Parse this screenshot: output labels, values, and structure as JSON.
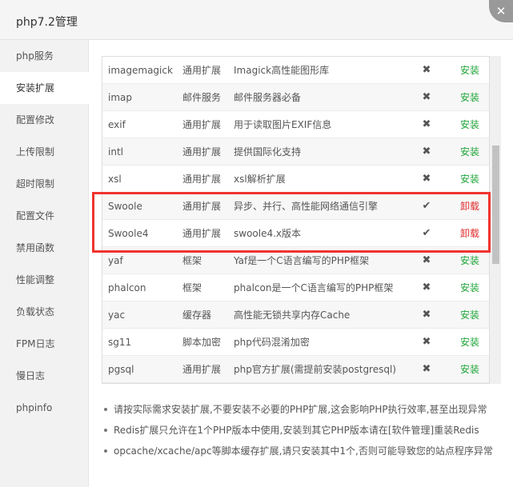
{
  "window": {
    "title": "php7.2管理",
    "close_symbol": "✕"
  },
  "sidebar": {
    "items": [
      {
        "label": "php服务"
      },
      {
        "label": "安装扩展"
      },
      {
        "label": "配置修改"
      },
      {
        "label": "上传限制"
      },
      {
        "label": "超时限制"
      },
      {
        "label": "配置文件"
      },
      {
        "label": "禁用函数"
      },
      {
        "label": "性能调整"
      },
      {
        "label": "负载状态"
      },
      {
        "label": "FPM日志"
      },
      {
        "label": "慢日志"
      },
      {
        "label": "phpinfo"
      }
    ],
    "active_index": 1
  },
  "extensions": {
    "rows": [
      {
        "name": "imagemagick",
        "type": "通用扩展",
        "desc": "Imagick高性能图形库",
        "status": "✖",
        "action": "安装"
      },
      {
        "name": "imap",
        "type": "邮件服务",
        "desc": "邮件服务器必备",
        "status": "✖",
        "action": "安装"
      },
      {
        "name": "exif",
        "type": "通用扩展",
        "desc": "用于读取图片EXIF信息",
        "status": "✖",
        "action": "安装"
      },
      {
        "name": "intl",
        "type": "通用扩展",
        "desc": "提供国际化支持",
        "status": "✖",
        "action": "安装"
      },
      {
        "name": "xsl",
        "type": "通用扩展",
        "desc": "xsl解析扩展",
        "status": "✖",
        "action": "安装"
      },
      {
        "name": "Swoole",
        "type": "通用扩展",
        "desc": "异步、并行、高性能网络通信引擎",
        "status": "✔",
        "action": "卸载"
      },
      {
        "name": "Swoole4",
        "type": "通用扩展",
        "desc": "swoole4.x版本",
        "status": "✔",
        "action": "卸载"
      },
      {
        "name": "yaf",
        "type": "框架",
        "desc": "Yaf是一个C语言编写的PHP框架",
        "status": "✖",
        "action": "安装"
      },
      {
        "name": "phalcon",
        "type": "框架",
        "desc": "phalcon是一个C语言编写的PHP框架",
        "status": "✖",
        "action": "安装"
      },
      {
        "name": "yac",
        "type": "缓存器",
        "desc": "高性能无锁共享内存Cache",
        "status": "✖",
        "action": "安装"
      },
      {
        "name": "sg11",
        "type": "脚本加密",
        "desc": "php代码混淆加密",
        "status": "✖",
        "action": "安装"
      },
      {
        "name": "pgsql",
        "type": "通用扩展",
        "desc": "php官方扩展(需提前安装postgresql)",
        "status": "✖",
        "action": "安装"
      }
    ]
  },
  "notes": [
    "请按实际需求安装扩展,不要安装不必要的PHP扩展,这会影响PHP执行效率,甚至出现异常",
    "Redis扩展只允许在1个PHP版本中使用,安装到其它PHP版本请在[软件管理]重装Redis",
    "opcache/xcache/apc等脚本缓存扩展,请只安装其中1个,否则可能导致您的站点程序异常"
  ],
  "colors": {
    "install": "#20a53a",
    "uninstall": "#e02b2b",
    "highlight_border": "#f0332e"
  }
}
